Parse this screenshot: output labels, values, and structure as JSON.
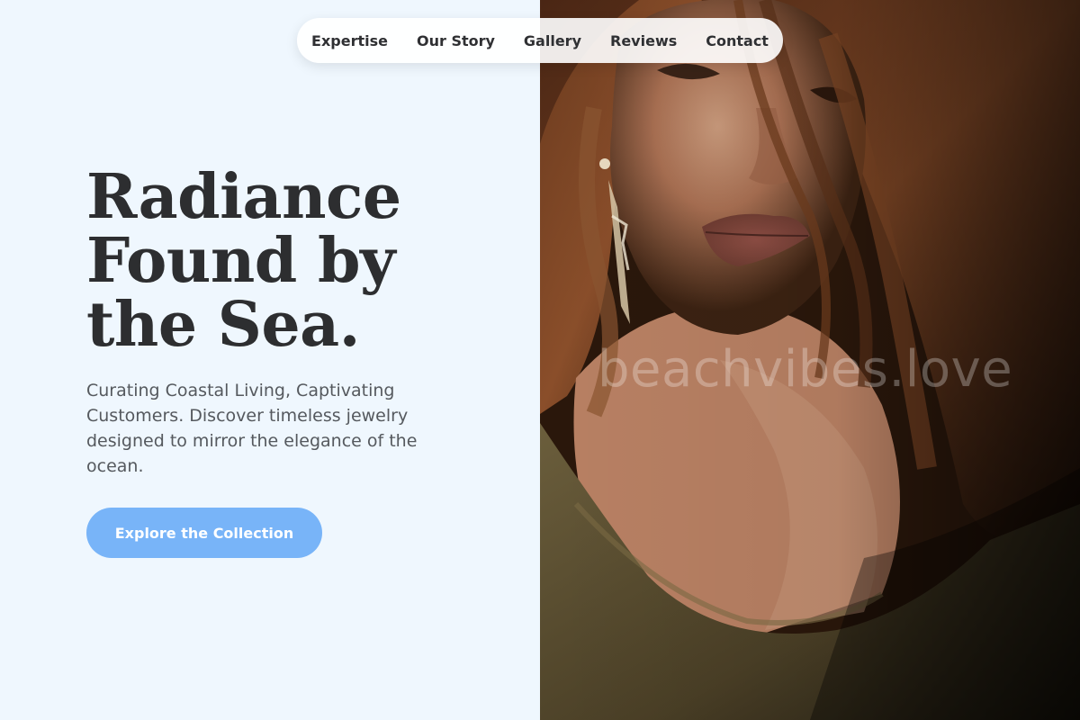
{
  "nav": {
    "items": [
      {
        "label": "Expertise"
      },
      {
        "label": "Our Story"
      },
      {
        "label": "Gallery"
      },
      {
        "label": "Reviews"
      },
      {
        "label": "Contact"
      }
    ]
  },
  "hero": {
    "title_lines": [
      "Radiance",
      "Found by",
      "the Sea."
    ],
    "subtitle": "Curating Coastal Living, Captivating Customers. Discover timeless jewelry designed to mirror the elegance of the ocean.",
    "cta_label": "Explore the Collection"
  },
  "photo": {
    "watermark": "beachvibes.love"
  },
  "colors": {
    "background": "#eff7fe",
    "accent": "#78b4f8",
    "heading": "#2d2e30",
    "body_text": "#55595e"
  }
}
